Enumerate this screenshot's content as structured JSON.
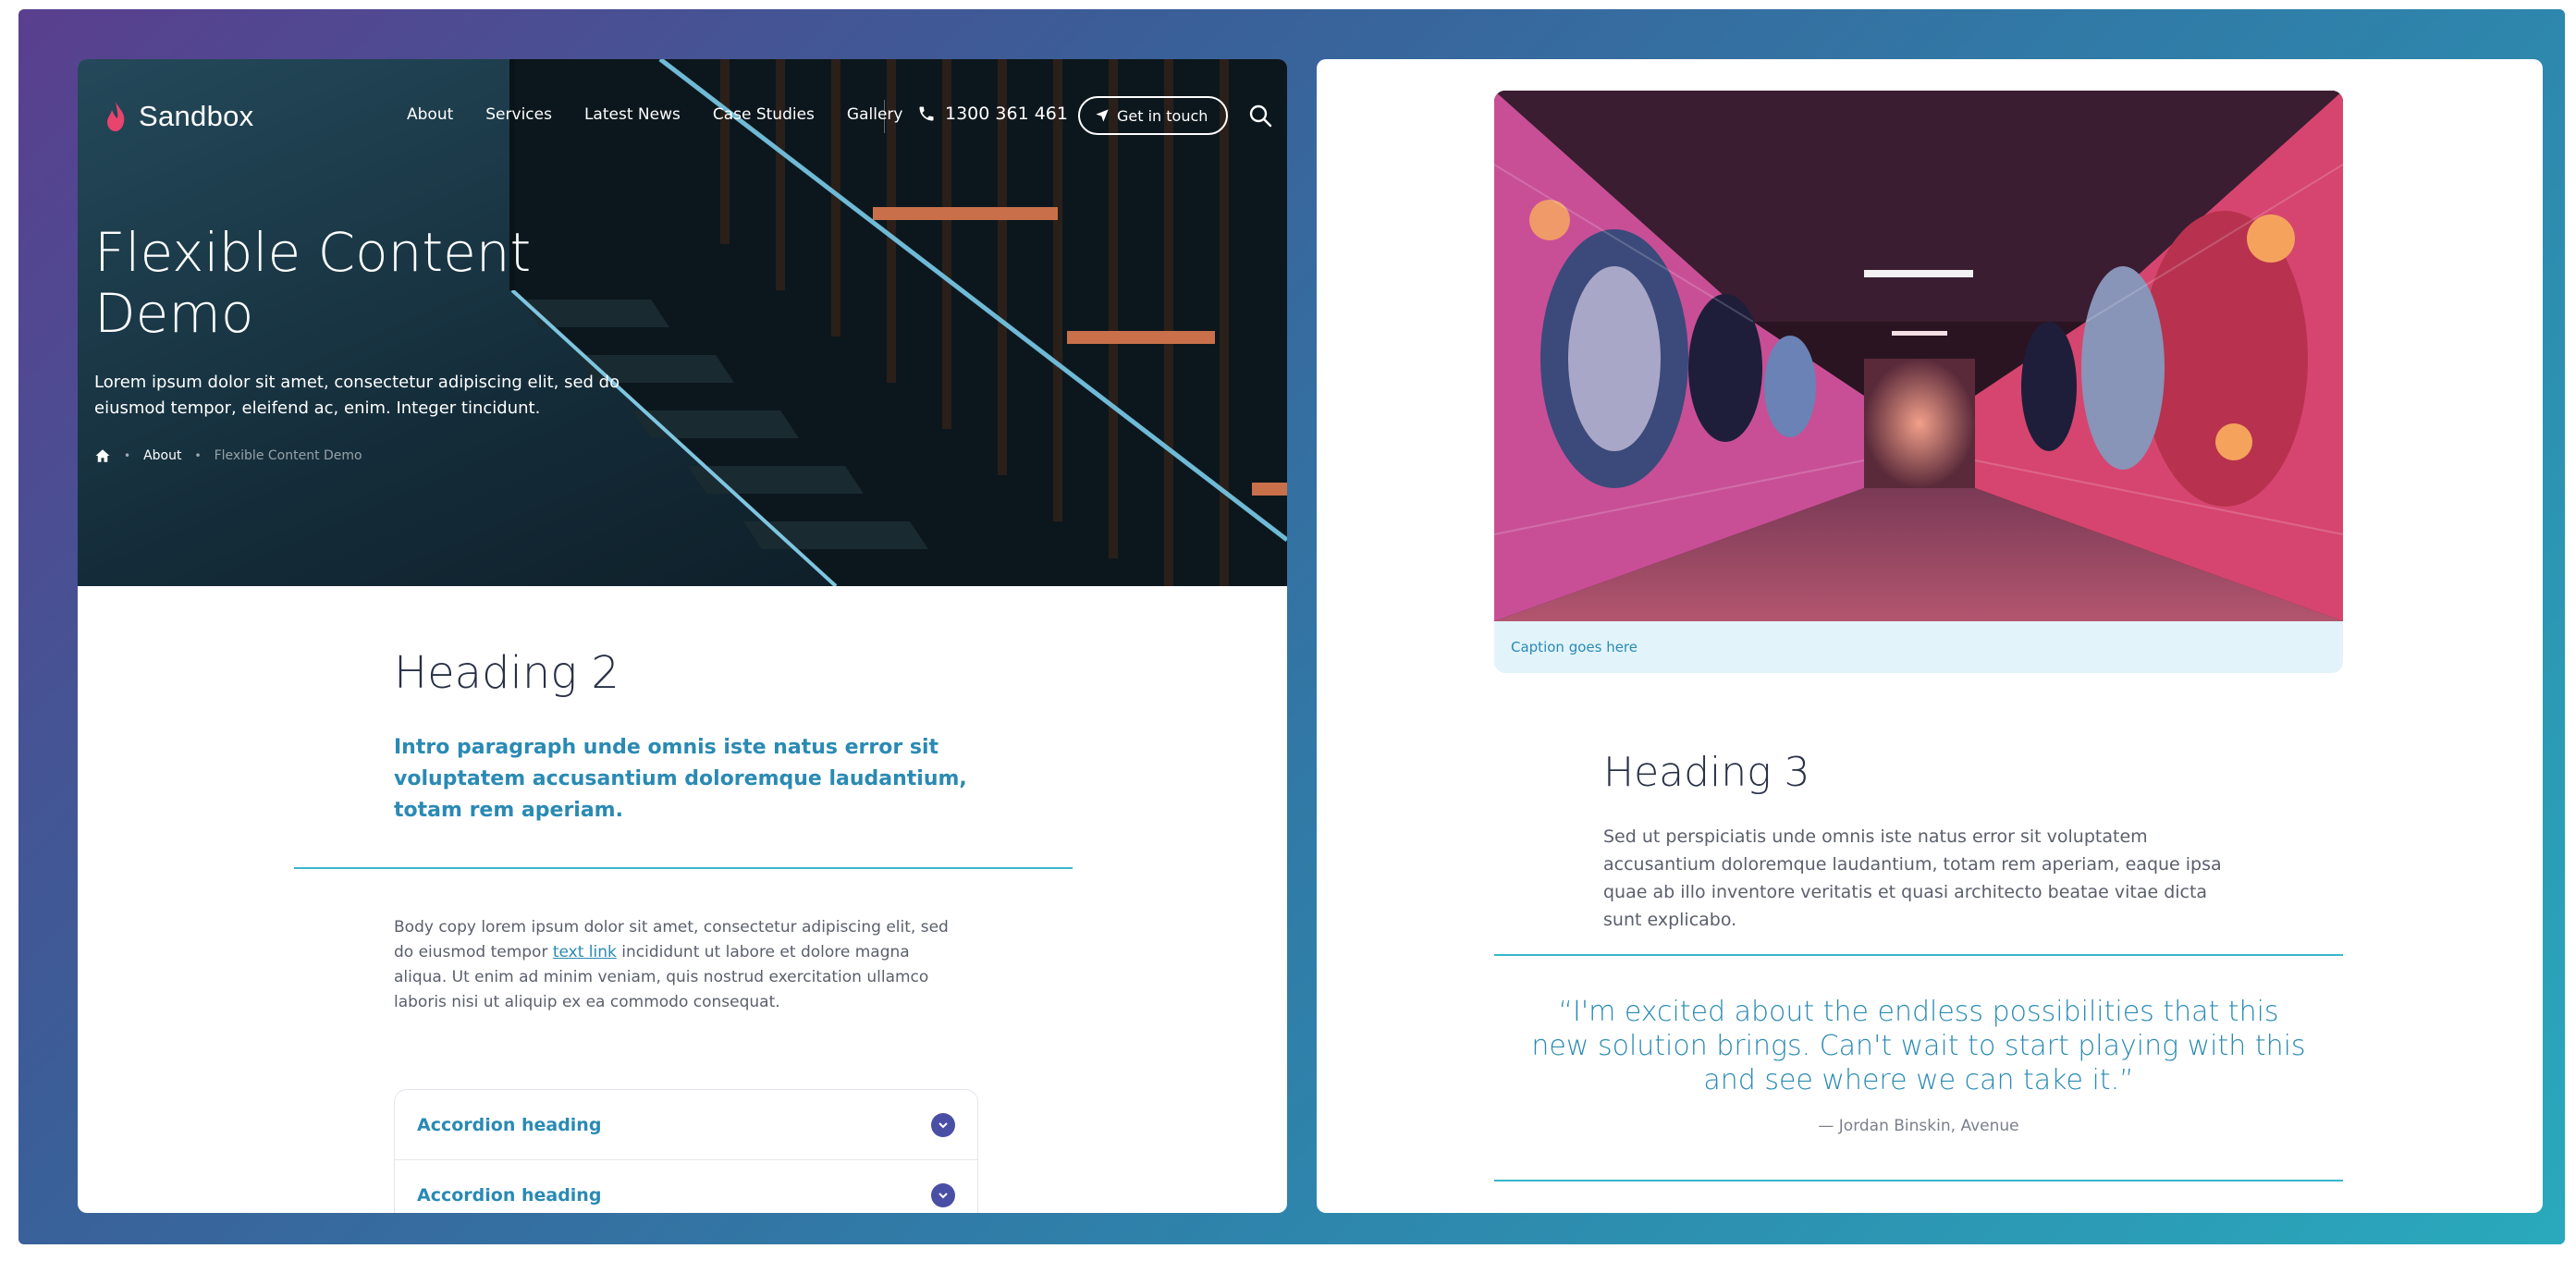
{
  "site": {
    "logo_text": "Sandbox",
    "logo_icon": "flame-icon",
    "accent_color": "#2a8ab4",
    "brand_color": "#e8446e",
    "divider_color": "#38b6cc"
  },
  "nav": {
    "links": [
      "About",
      "Services",
      "Latest News",
      "Case Studies",
      "Gallery"
    ],
    "phone": "1300 361 461",
    "phone_icon": "phone-icon",
    "cta_label": "Get in touch",
    "cta_icon": "send-icon",
    "search_icon": "search-icon"
  },
  "hero": {
    "title": "Flexible Content Demo",
    "subtitle": "Lorem ipsum dolor sit amet, consectetur adipiscing elit, sed do eiusmod tempor, eleifend ac, enim. Integer tincidunt.",
    "breadcrumb": {
      "home_icon": "home-icon",
      "parent": "About",
      "current": "Flexible Content Demo"
    }
  },
  "content": {
    "heading2": "Heading 2",
    "intro": "Intro paragraph unde omnis iste natus error sit voluptatem accusantium doloremque laudantium, totam rem aperiam.",
    "body_before_link": "Body copy lorem ipsum dolor sit amet, consectetur adipiscing elit, sed do eiusmod tempor ",
    "body_link": "text link",
    "body_after_link": " incididunt ut labore et dolore magna aliqua. Ut enim ad minim veniam, quis nostrud exercitation ullamco laboris nisi ut aliquip ex ea commodo consequat.",
    "accordion": [
      {
        "label": "Accordion heading"
      },
      {
        "label": "Accordion heading"
      }
    ]
  },
  "right": {
    "caption": "Caption goes here",
    "heading3": "Heading 3",
    "paragraph": "Sed ut perspiciatis unde omnis iste natus error sit voluptatem accusantium doloremque laudantium, totam rem aperiam, eaque ipsa quae ab illo inventore veritatis et quasi architecto beatae vitae dicta sunt explicabo.",
    "quote": "“I'm excited about the endless possibilities that this new solution brings. Can't wait to start playing with this and see where we can take it.”",
    "quote_author": "— Jordan Binskin, Avenue"
  }
}
